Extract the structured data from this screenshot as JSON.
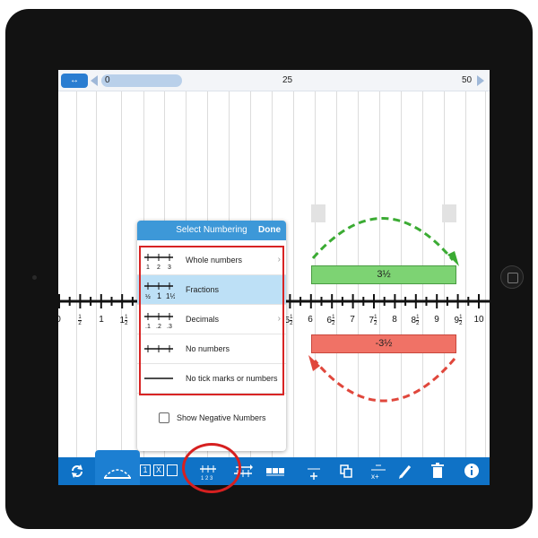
{
  "range_bar": {
    "toggle_icon": "range-toggle-icon",
    "start": "0",
    "middle": "25",
    "end": "50"
  },
  "number_line": {
    "labels": [
      {
        "whole": "0",
        "frac": ""
      },
      {
        "whole": "",
        "frac": "1/2"
      },
      {
        "whole": "1",
        "frac": ""
      },
      {
        "whole": "1",
        "frac": "1/2"
      },
      {
        "whole": "5",
        "frac": "1/2"
      },
      {
        "whole": "6",
        "frac": ""
      },
      {
        "whole": "6",
        "frac": "1/2"
      },
      {
        "whole": "7",
        "frac": ""
      },
      {
        "whole": "7",
        "frac": "1/2"
      },
      {
        "whole": "8",
        "frac": ""
      },
      {
        "whole": "8",
        "frac": "1/2"
      },
      {
        "whole": "9",
        "frac": ""
      },
      {
        "whole": "9",
        "frac": "1/2"
      },
      {
        "whole": "10",
        "frac": ""
      }
    ],
    "positive_jump": {
      "value": "3½",
      "color": "#7dd373",
      "arrow_color": "#3bab33"
    },
    "negative_jump": {
      "value": "-3½",
      "color": "#f07266",
      "arrow_color": "#e0473c"
    }
  },
  "numbering_panel": {
    "title": "Select Numbering",
    "done_label": "Done",
    "options": [
      {
        "label": "Whole numbers",
        "selected": false,
        "icon": "whole-numbers-icon"
      },
      {
        "label": "Fractions",
        "selected": true,
        "icon": "fractions-icon"
      },
      {
        "label": "Decimals",
        "selected": false,
        "icon": "decimals-icon"
      },
      {
        "label": "No numbers",
        "selected": false,
        "icon": "no-numbers-icon"
      },
      {
        "label": "No tick marks or numbers",
        "selected": false,
        "icon": "no-ticks-icon"
      }
    ],
    "show_negative_label": "Show Negative Numbers",
    "show_negative_checked": false
  },
  "toolbar": {
    "tools": [
      "reset-icon",
      "ruler-icon",
      "numbering-icon",
      "jump-icon",
      "segments-icon",
      "add-icon",
      "copy-icon",
      "operations-icon",
      "pencil-icon",
      "trash-icon",
      "info-icon"
    ],
    "mini_boxes": [
      "1",
      "X",
      ""
    ]
  },
  "colors": {
    "accent": "#0f72c6",
    "header": "#3d98d8",
    "highlight": "#d82424"
  }
}
